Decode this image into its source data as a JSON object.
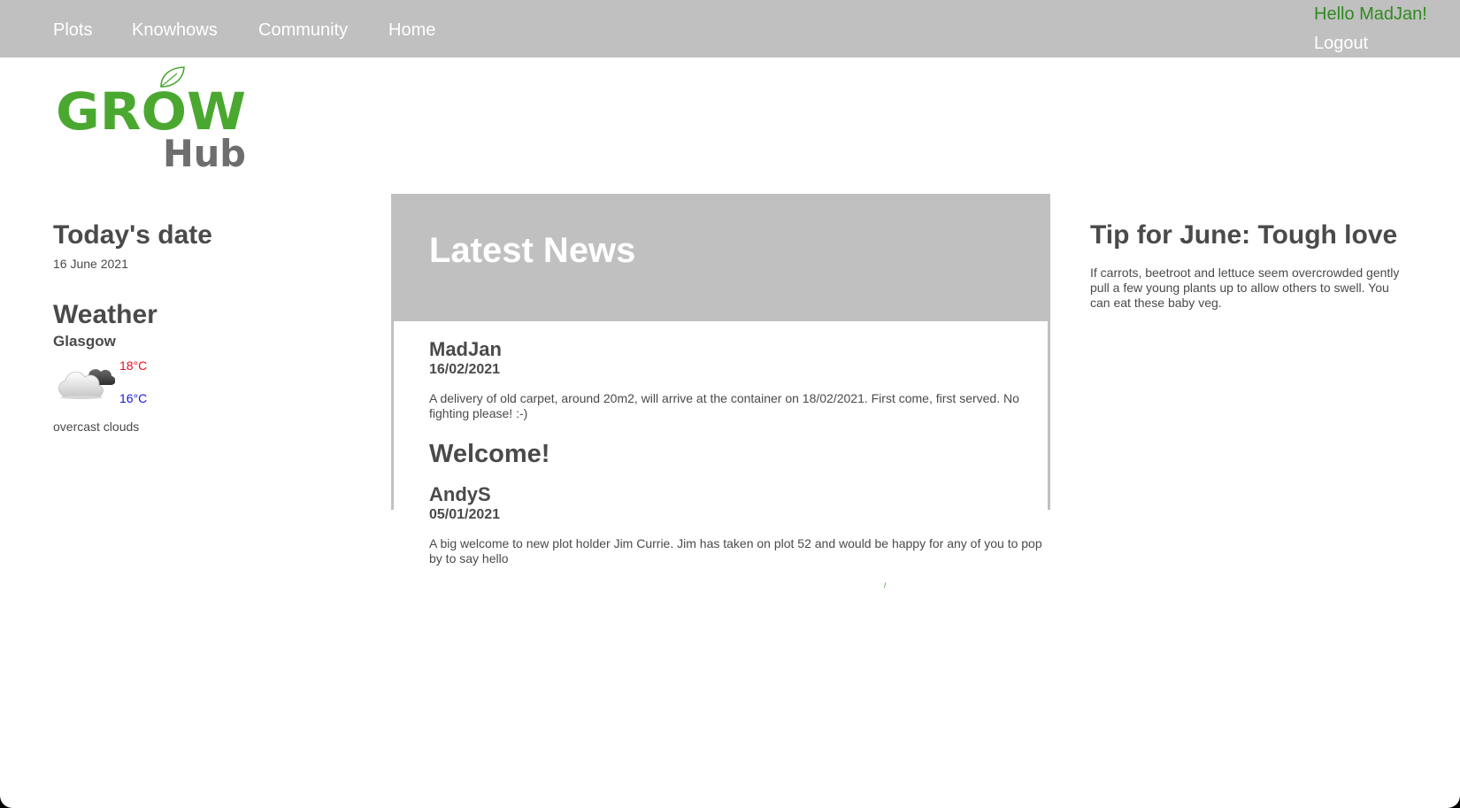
{
  "nav": {
    "links": [
      "Plots",
      "Knowhows",
      "Community",
      "Home"
    ],
    "greeting": "Hello MadJan!",
    "logout": "Logout"
  },
  "logo": {
    "line1": "GROW",
    "line2": "Hub",
    "green": "#4aa830",
    "gray": "#6e6e6e"
  },
  "sidebar": {
    "date_heading": "Today's date",
    "date_value": "16 June 2021",
    "weather_heading": "Weather",
    "city": "Glasgow",
    "temp_high": "18°C",
    "temp_low": "16°C",
    "condition": "overcast clouds",
    "icon": "cloud-icon"
  },
  "news": {
    "title": "Latest News",
    "posts": [
      {
        "author": "MadJan",
        "date": "16/02/2021",
        "text": "A delivery of old carpet, around 20m2, will arrive at the container on 18/02/2021. First come, first served. No fighting please! :-)"
      },
      {
        "heading": "Welcome!",
        "author": "AndyS",
        "date": "05/01/2021",
        "text": "A big welcome to new plot holder Jim Currie. Jim has taken on plot 52 and would be happy for any of you to pop by to say hello"
      }
    ]
  },
  "tip": {
    "title": "Tip for June: Tough love",
    "text": "If carrots, beetroot and lettuce seem overcrowded gently pull a few young plants up to allow others to swell. You can eat these baby veg."
  },
  "colors": {
    "bar": "#c0c0c0",
    "text": "#4a4a4a",
    "accent_green": "#2e8b1e",
    "temp_high": "#e8101a",
    "temp_low": "#1418d8"
  }
}
